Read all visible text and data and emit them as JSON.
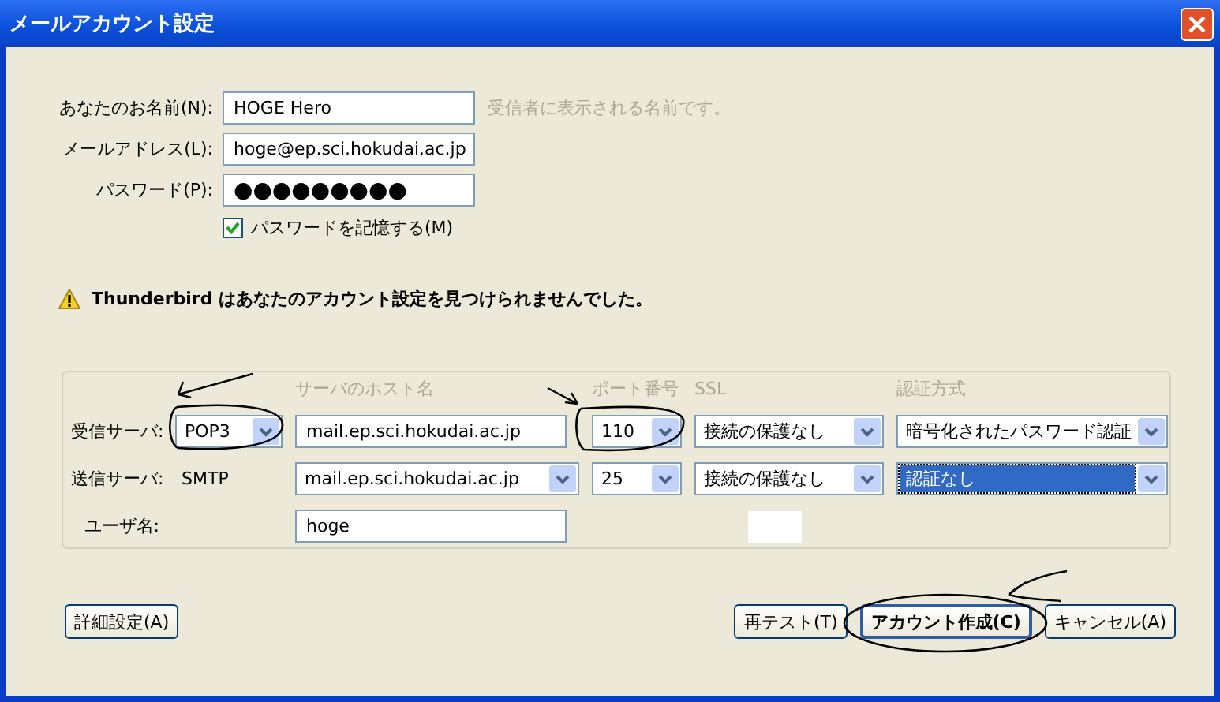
{
  "window": {
    "title": "メールアカウント設定"
  },
  "identity": [
    {
      "label": "あなたのお名前(N):",
      "value": "HOGE Hero",
      "hint": "受信者に表示される名前です。"
    },
    {
      "label": "メールアドレス(L):",
      "value": "hoge@ep.sci.hokudai.ac.jp"
    },
    {
      "label": "パスワード(P):",
      "value": "●●●●●●●●●"
    }
  ],
  "remember_password": {
    "label": "パスワードを記憶する(M)",
    "checked": true
  },
  "warning": "Thunderbird はあなたのアカウント設定を見つけられませんでした。",
  "servers": {
    "headers": [
      "サーバのホスト名",
      "ポート番号",
      "SSL",
      "認証方式"
    ],
    "rows": [
      {
        "kind": "incoming",
        "label": "受信サーバ:",
        "protocol": "POP3",
        "host": "mail.ep.sci.hokudai.ac.jp",
        "port": "110",
        "ssl": "接続の保護なし",
        "auth": "暗号化されたパスワード認証",
        "auth_focused": false
      },
      {
        "kind": "outgoing",
        "label": "送信サーバ:",
        "protocol": "SMTP",
        "host": "mail.ep.sci.hokudai.ac.jp",
        "port": "25",
        "ssl": "接続の保護なし",
        "auth": "認証なし",
        "auth_focused": true
      }
    ],
    "username": {
      "label": "ユーザ名:",
      "value": "hoge"
    }
  },
  "buttons_left": [
    {
      "label": "詳細設定(A)",
      "default": false
    }
  ],
  "buttons_right": [
    {
      "label": "再テスト(T)",
      "default": false
    },
    {
      "label": "アカウント作成(C)",
      "default": true
    },
    {
      "label": "キャンセル(A)",
      "default": false
    }
  ]
}
